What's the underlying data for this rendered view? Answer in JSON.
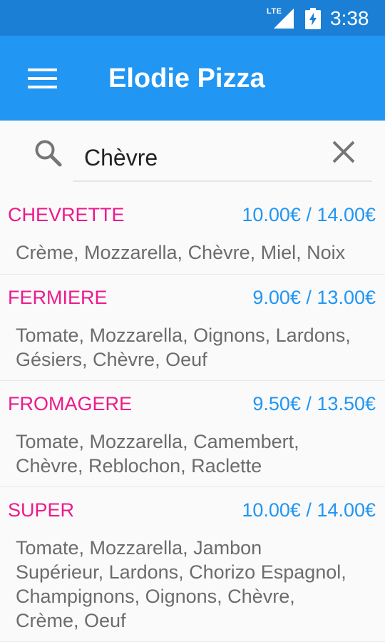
{
  "status_bar": {
    "network": "LTE",
    "time": "3:38",
    "icons": [
      "lte-signal-icon",
      "battery-charging-icon"
    ]
  },
  "app_bar": {
    "title": "Elodie Pizza",
    "menu_icon": "hamburger-menu-icon",
    "color": "#2196f3",
    "status_color": "#1b7fd6"
  },
  "search": {
    "value": "Chèvre",
    "icon": "search-icon",
    "clear_icon": "close-icon"
  },
  "colors": {
    "pizza_name": "#ec1a8c",
    "price": "#2196f3",
    "ingredients": "#6c6c6c"
  },
  "pizzas": [
    {
      "name": "CHEVRETTE",
      "price": "10.00€ / 14.00€",
      "ingredients_lines": [
        "Crème, Mozzarella, Chèvre, Miel, Noix"
      ]
    },
    {
      "name": "FERMIERE",
      "price": "9.00€ / 13.00€",
      "ingredients_lines": [
        "Tomate, Mozzarella, Oignons, Lardons,",
        "Gésiers, Chèvre, Oeuf"
      ]
    },
    {
      "name": "FROMAGERE",
      "price": "9.50€ / 13.50€",
      "ingredients_lines": [
        "Tomate, Mozzarella, Camembert,",
        "Chèvre, Reblochon, Raclette"
      ]
    },
    {
      "name": "SUPER",
      "price": "10.00€ / 14.00€",
      "ingredients_lines": [
        "Tomate, Mozzarella, Jambon",
        "Supérieur, Lardons, Chorizo Espagnol,",
        "Champignons, Oignons, Chèvre,",
        "Crème, Oeuf"
      ]
    }
  ]
}
